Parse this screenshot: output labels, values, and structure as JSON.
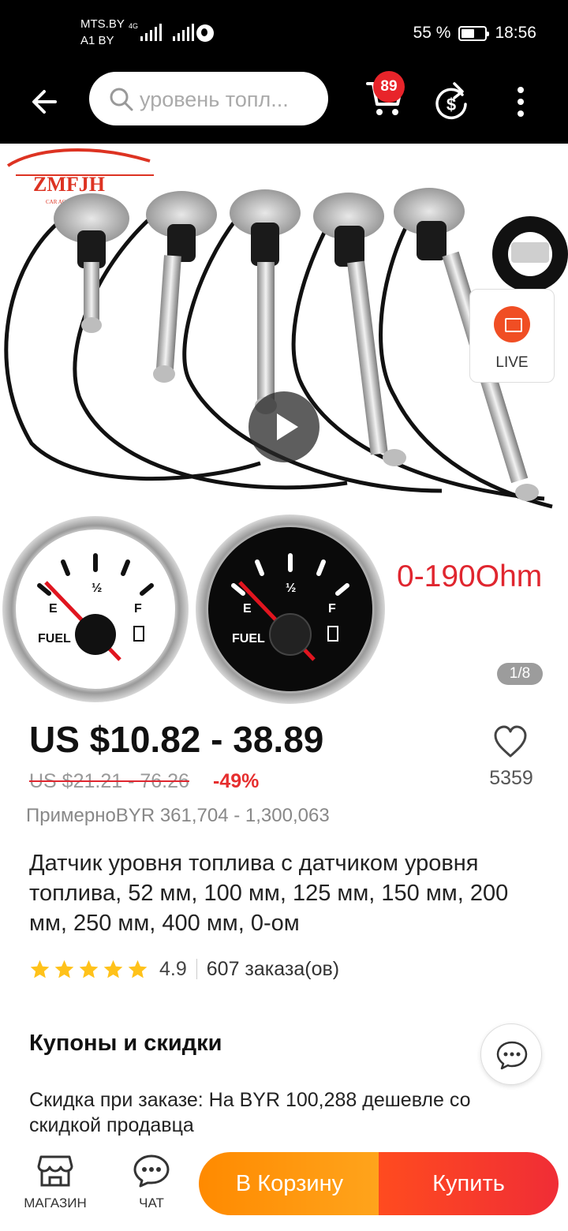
{
  "status_bar": {
    "carrier_1": "MTS.BY",
    "carrier_2": "A1 BY",
    "network_tag": "4G",
    "battery_text": "55 %",
    "battery_level": 0.55,
    "time": "18:56"
  },
  "header": {
    "search_text": "уровень топл...",
    "cart_count": "89"
  },
  "gallery": {
    "brand_logo_text": "ZMFJH",
    "brand_logo_subtitle": "CAR ACCESSORIES",
    "resistance_label": "0-190Ohm",
    "gauge_labels": {
      "empty": "E",
      "half": "½",
      "full": "F",
      "fuel": "FUEL"
    },
    "live_label": "LIVE",
    "counter": "1/8"
  },
  "product": {
    "price": "US $10.82 - 38.89",
    "old_price": "US $21.21 - 76.26",
    "discount": "-49%",
    "approx_price": "ПримерноBYR 361,704 - 1,300,063",
    "wishlist_count": "5359",
    "title": "Датчик уровня топлива с датчиком уровня топлива, 52 мм, 100 мм, 125 мм, 150 мм, 200 мм, 250 мм, 400 мм, 0-ом",
    "rating": "4.9",
    "rating_stars": 5,
    "orders": "607 заказа(ов)"
  },
  "coupons": {
    "section_title": "Купоны и скидки",
    "discount_text": "Скидка при заказе: На BYR 100,288 дешевле со скидкой продавца"
  },
  "bottom_bar": {
    "store_label": "МАГАЗИН",
    "chat_label": "ЧАТ",
    "add_to_cart": "В Корзину",
    "buy": "Купить"
  },
  "colors": {
    "accent_red": "#e8242a",
    "cart_orange": "#ff8a00",
    "buy_red": "#f02d36",
    "discount_red": "#e62e2e",
    "star_yellow": "#ffc21a"
  }
}
